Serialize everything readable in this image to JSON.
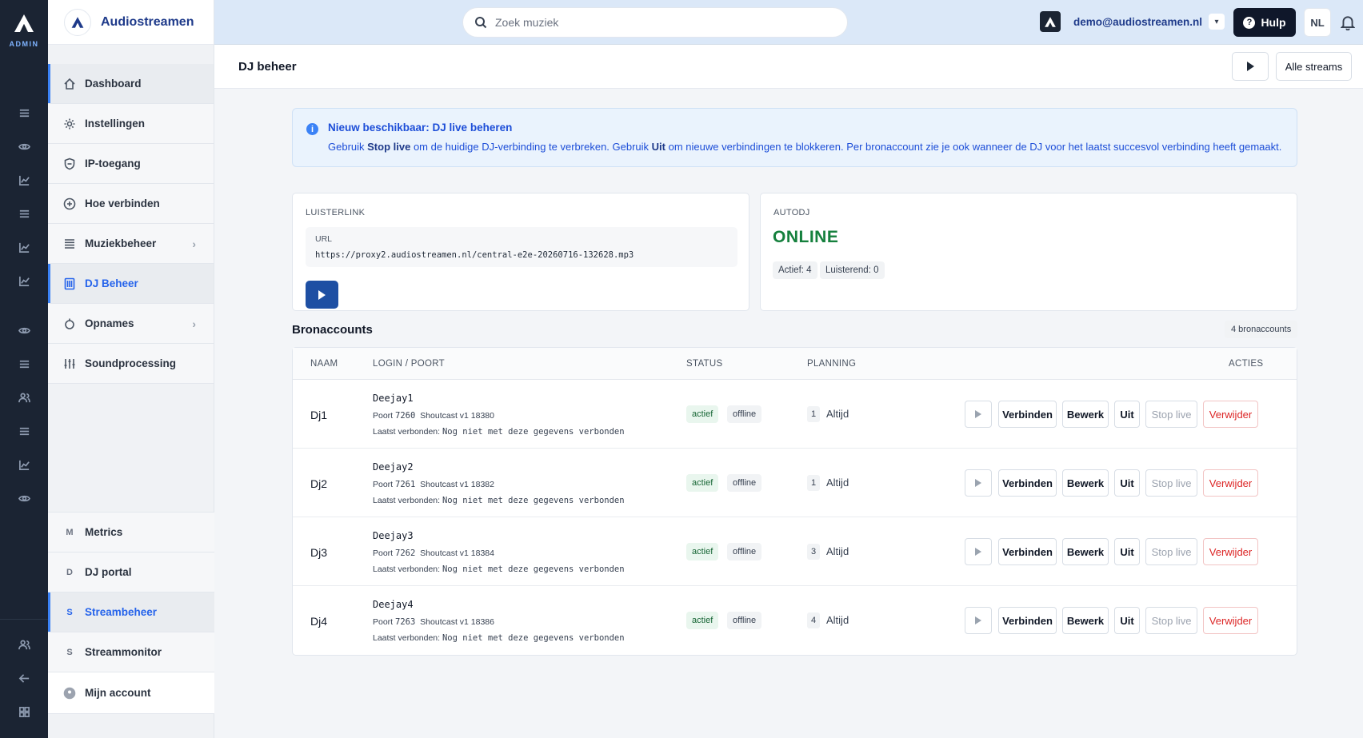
{
  "rail": {
    "admin_label": "ADMIN"
  },
  "brand": {
    "name": "Audiostreamen"
  },
  "sidebar": {
    "items": [
      {
        "label": "Dashboard",
        "icon": "home-icon"
      },
      {
        "label": "Instellingen",
        "icon": "gear-icon"
      },
      {
        "label": "IP-toegang",
        "icon": "shield-icon"
      },
      {
        "label": "Hoe verbinden",
        "icon": "plus-circle-icon"
      },
      {
        "label": "Muziekbeheer",
        "icon": "list-icon"
      },
      {
        "label": "DJ Beheer",
        "icon": "dj-icon"
      },
      {
        "label": "Opnames",
        "icon": "record-icon"
      },
      {
        "label": "Soundprocessing",
        "icon": "equalizer-icon"
      }
    ],
    "bottom_items": [
      {
        "letter": "M",
        "label": "Metrics"
      },
      {
        "letter": "D",
        "label": "DJ portal"
      },
      {
        "letter": "S",
        "label": "Streambeheer"
      },
      {
        "letter": "S",
        "label": "Streammonitor"
      }
    ],
    "account_label": "Mijn account"
  },
  "header": {
    "search_placeholder": "Zoek muziek",
    "user_email": "demo@audiostreamen.nl",
    "help_label": "Hulp",
    "language": "NL"
  },
  "subheader": {
    "title": "DJ beheer",
    "all_streams_label": "Alle streams"
  },
  "alert": {
    "title": "Nieuw beschikbaar: DJ live beheren",
    "text_1": "Gebruik ",
    "bold_1": "Stop live",
    "text_2": " om de huidige DJ-verbinding te verbreken. Gebruik ",
    "bold_2": "Uit",
    "text_3": " om nieuwe verbindingen te blokkeren. Per bronaccount zie je ook wanneer de DJ voor het laatst succesvol verbinding heeft gemaakt."
  },
  "listen": {
    "label": "LUISTERLINK",
    "url_label": "URL",
    "url": "https://proxy2.audiostreamen.nl/central-e2e-20260716-132628.mp3"
  },
  "autodj": {
    "label": "AUTODJ",
    "status": "ONLINE",
    "active": "Actief: 4",
    "listening": "Luisterend: 0"
  },
  "sources": {
    "title": "Bronaccounts",
    "count": "4 bronaccounts",
    "columns": {
      "name": "NAAM",
      "login": "LOGIN / POORT",
      "status": "STATUS",
      "planning": "PLANNING",
      "actions": "ACTIES"
    },
    "rows": [
      {
        "name": "Dj1",
        "login": "Deejay1",
        "port_label": "Poort",
        "port": "7260",
        "proto": "Shoutcast v1 18380",
        "last_label": "Laatst verbonden:",
        "last": "Nog niet met deze gegevens verbonden",
        "status": "actief",
        "conn": "offline",
        "plan_num": "1",
        "plan": "Altijd"
      },
      {
        "name": "Dj2",
        "login": "Deejay2",
        "port_label": "Poort",
        "port": "7261",
        "proto": "Shoutcast v1 18382",
        "last_label": "Laatst verbonden:",
        "last": "Nog niet met deze gegevens verbonden",
        "status": "actief",
        "conn": "offline",
        "plan_num": "1",
        "plan": "Altijd"
      },
      {
        "name": "Dj3",
        "login": "Deejay3",
        "port_label": "Poort",
        "port": "7262",
        "proto": "Shoutcast v1 18384",
        "last_label": "Laatst verbonden:",
        "last": "Nog niet met deze gegevens verbonden",
        "status": "actief",
        "conn": "offline",
        "plan_num": "3",
        "plan": "Altijd"
      },
      {
        "name": "Dj4",
        "login": "Deejay4",
        "port_label": "Poort",
        "port": "7263",
        "proto": "Shoutcast v1 18386",
        "last_label": "Laatst verbonden:",
        "last": "Nog niet met deze gegevens verbonden",
        "status": "actief",
        "conn": "offline",
        "plan_num": "4",
        "plan": "Altijd"
      }
    ],
    "actions": {
      "connect": "Verbinden",
      "edit": "Bewerk",
      "off": "Uit",
      "stop": "Stop live",
      "delete": "Verwijder"
    }
  },
  "colors": {
    "accent": "#2563eb",
    "online": "#15803d",
    "danger": "#dc2626",
    "rail": "#1b2433"
  }
}
